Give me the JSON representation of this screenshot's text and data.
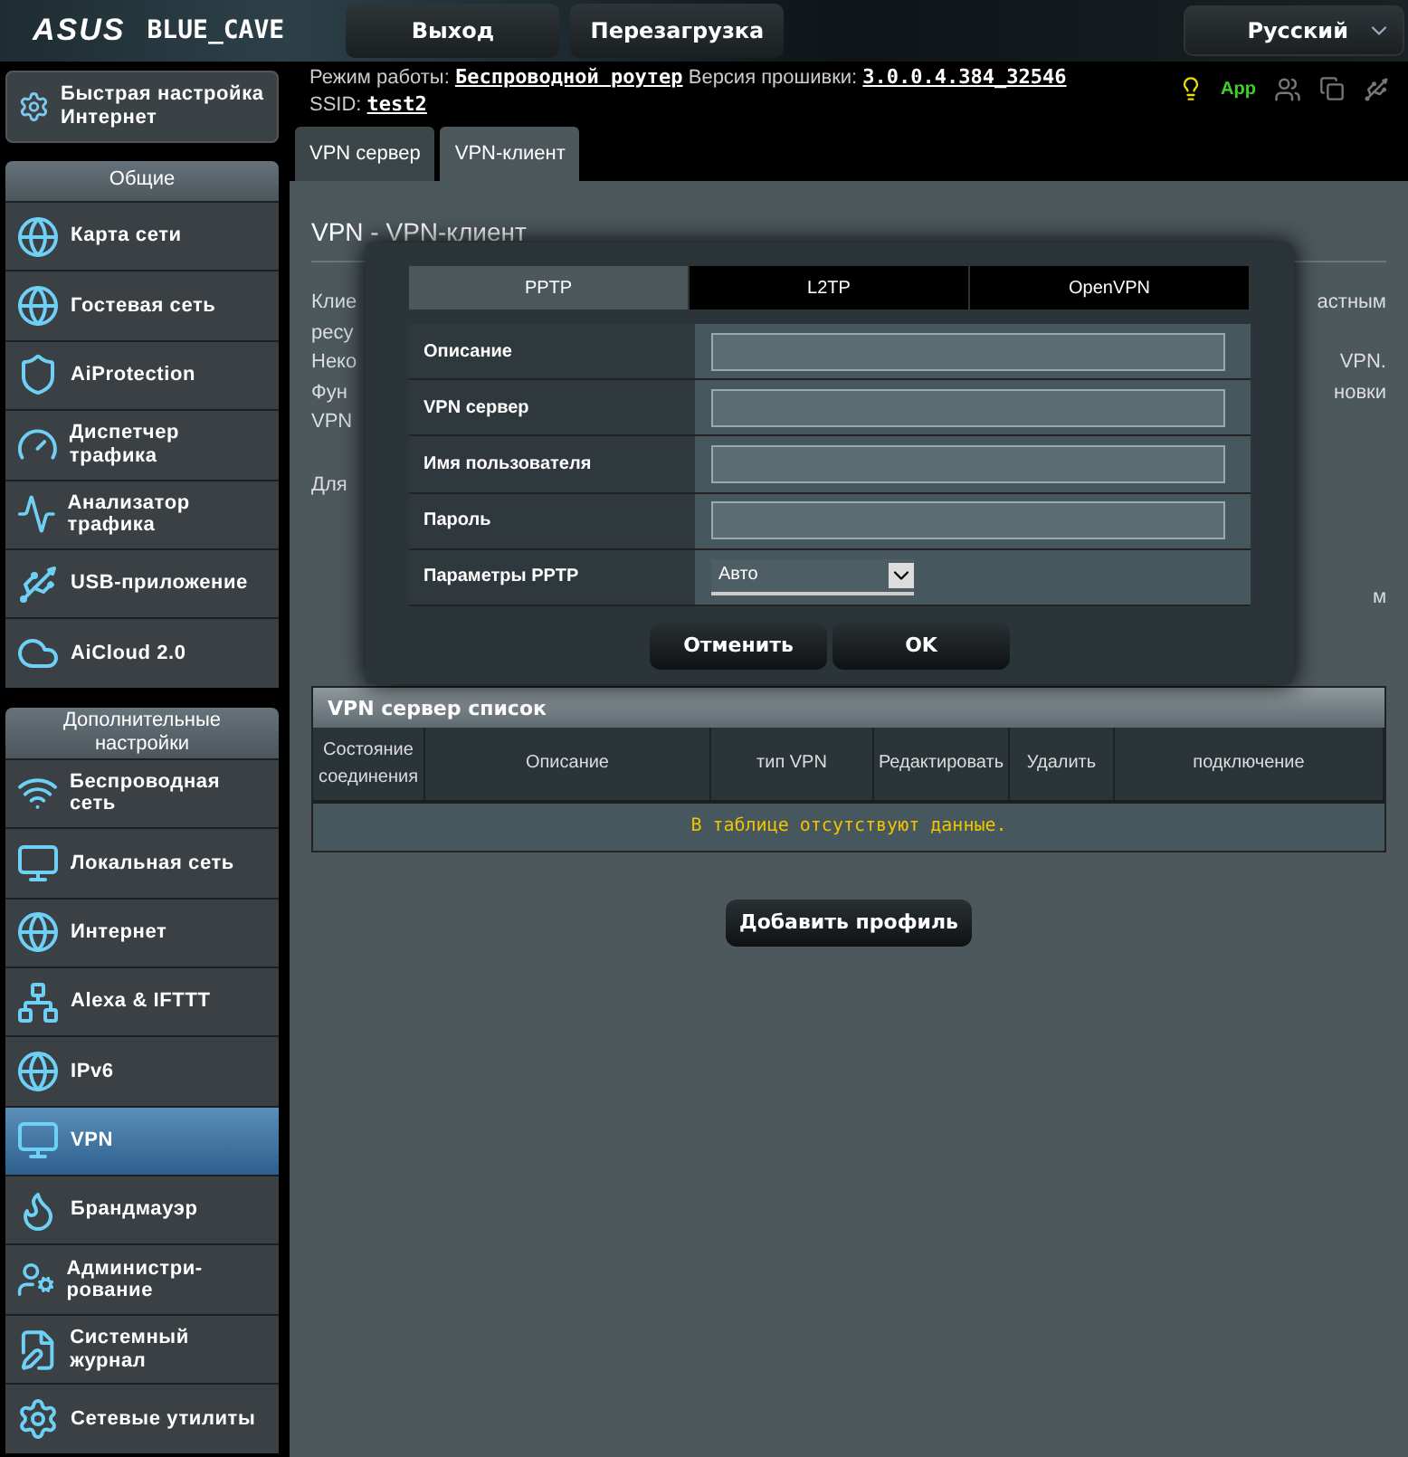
{
  "brand": {
    "logo": "ASUS",
    "model": "BLUE_CAVE"
  },
  "top_buttons": [
    "Выход",
    "Перезагрузка"
  ],
  "language": "Русский",
  "info": {
    "mode_label": "Режим работы:",
    "mode": "Беспроводной роутер",
    "fw_label": "Версия прошивки:",
    "fw": "3.0.0.4.384_32546",
    "ssid_label": "SSID:",
    "ssid": "test2"
  },
  "app_label": "App",
  "quick_setup": "Быстрая настройка Интернет",
  "sidebar": [
    {
      "title": "Общие",
      "items": [
        {
          "label": "Карта сети",
          "selected": false
        },
        {
          "label": "Гостевая сеть",
          "selected": false
        },
        {
          "label": "AiProtection",
          "selected": false
        },
        {
          "label": "Диспетчер трафика",
          "selected": false
        },
        {
          "label": "Анализатор трафика",
          "selected": false
        },
        {
          "label": "USB-приложение",
          "selected": false
        },
        {
          "label": "AiCloud 2.0",
          "selected": false
        }
      ]
    },
    {
      "title": "Дополнительные настройки",
      "items": [
        {
          "label": "Беспроводная сеть",
          "selected": false
        },
        {
          "label": "Локальная сеть",
          "selected": false
        },
        {
          "label": "Интернет",
          "selected": false
        },
        {
          "label": "Alexa & IFTTT",
          "selected": false
        },
        {
          "label": "IPv6",
          "selected": false
        },
        {
          "label": "VPN",
          "selected": true
        },
        {
          "label": "Брандмауэр",
          "selected": false
        },
        {
          "label": "Администри-рование",
          "selected": false
        },
        {
          "label": "Системный журнал",
          "selected": false
        },
        {
          "label": "Сетевые утилиты",
          "selected": false
        }
      ]
    }
  ],
  "tabs": [
    {
      "label": "VPN сервер",
      "selected": false
    },
    {
      "label": "VPN-клиент",
      "selected": true
    }
  ],
  "page_title": "VPN - VPN-клиент",
  "description_lines": [
    {
      "left": "Клие",
      "right": "астным"
    },
    {
      "left": "ресу"
    },
    {
      "left": "Неко",
      "right": "VPN."
    },
    {
      "left": "Фун",
      "right": "новки"
    },
    {
      "left": "VPN"
    }
  ],
  "note_left": "Для",
  "note_right": "м",
  "dialog": {
    "tabs": [
      {
        "label": "PPTP",
        "selected": true
      },
      {
        "label": "L2TP",
        "selected": false
      },
      {
        "label": "OpenVPN",
        "selected": false
      }
    ],
    "fields": [
      {
        "label": "Описание",
        "kind": "text"
      },
      {
        "label": "VPN сервер",
        "kind": "text"
      },
      {
        "label": "Имя пользователя",
        "kind": "text"
      },
      {
        "label": "Пароль",
        "kind": "text"
      },
      {
        "label": "Параметры PPTP",
        "kind": "select",
        "value": "Авто"
      }
    ],
    "buttons": [
      "Отменить",
      "OK"
    ]
  },
  "table": {
    "title": "VPN сервер список",
    "columns": [
      "Состояние соединения",
      "Описание",
      "тип VPN",
      "Редактировать",
      "Удалить",
      "подключение"
    ],
    "empty_message": "В таблице отсутствуют данные."
  },
  "add_button": "Добавить профиль"
}
